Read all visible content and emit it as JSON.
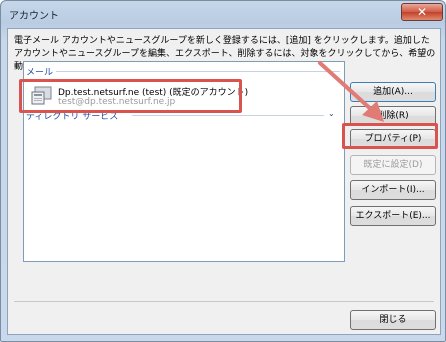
{
  "window": {
    "title": "アカウント",
    "close_glyph": "✕"
  },
  "description": "電子メール アカウントやニュースグループを新しく登録するには、[追加] をクリックします。追加したアカウントやニュースグループを編集、エクスポート、削除するには、対象をクリックしてから、希望の動作をクリックします。",
  "list": {
    "mail_section": "メール",
    "account": {
      "name": "Dp.test.netsurf.ne (test) (既定のアカウント)",
      "email": "test@dp.test.netsurf.ne.jp",
      "icon": "mail-account-icon"
    },
    "directory_section": "ディレクトリ サービス",
    "collapse_glyph": "⌄"
  },
  "buttons": {
    "add": "追加(A)...",
    "delete": "削除(R)",
    "properties": "プロパティ(P)",
    "set_default": "既定に設定(D)",
    "import": "インポート(I)...",
    "export": "エクスポート(E)...",
    "close": "閉じる"
  },
  "colors": {
    "highlight_box": "#d9534f",
    "section_text": "#1e4da1"
  }
}
